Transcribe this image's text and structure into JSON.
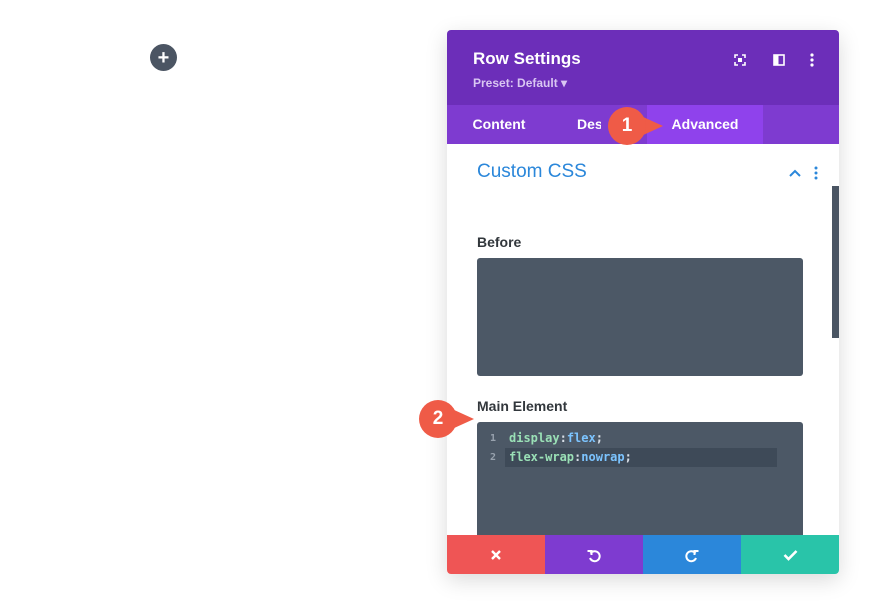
{
  "canvas": {
    "add_button_symbol": "+",
    "add_button_icon": "plus-icon"
  },
  "modal": {
    "title": "Row Settings",
    "preset": "Preset: Default ▾",
    "header_icons": [
      "fullscreen-icon",
      "split-view-icon",
      "more-vertical-icon"
    ],
    "tabs": [
      {
        "label": "Content",
        "active": false
      },
      {
        "label": "Design",
        "active": false
      },
      {
        "label": "Advanced",
        "active": true
      }
    ]
  },
  "section": {
    "title": "Custom CSS",
    "expanded": true,
    "fields": [
      {
        "label": "Before",
        "code": []
      },
      {
        "label": "Main Element",
        "code": [
          {
            "line": "1",
            "property": "display",
            "colon": ":",
            "value": "flex",
            "end": ";"
          },
          {
            "line": "2",
            "property": "flex-wrap",
            "colon": ":",
            "value": "nowrap",
            "end": ";"
          }
        ]
      }
    ]
  },
  "footer": {
    "buttons": [
      {
        "name": "cancel",
        "icon": "close-icon",
        "color": "#ef5555"
      },
      {
        "name": "undo",
        "icon": "undo-icon",
        "color": "#7e3bd0"
      },
      {
        "name": "redo",
        "icon": "redo-icon",
        "color": "#2b87da"
      },
      {
        "name": "save",
        "icon": "checkmark-icon",
        "color": "#29c4a9"
      }
    ]
  },
  "annotations": [
    {
      "number": "1",
      "color": "#ef5b47"
    },
    {
      "number": "2",
      "color": "#ef5b47"
    }
  ],
  "colors": {
    "header": "#6c2eb9",
    "tabbar": "#7e3bd0",
    "tab_active": "#8f42ec",
    "accent": "#2b87da",
    "code_bg": "#4c5866"
  }
}
